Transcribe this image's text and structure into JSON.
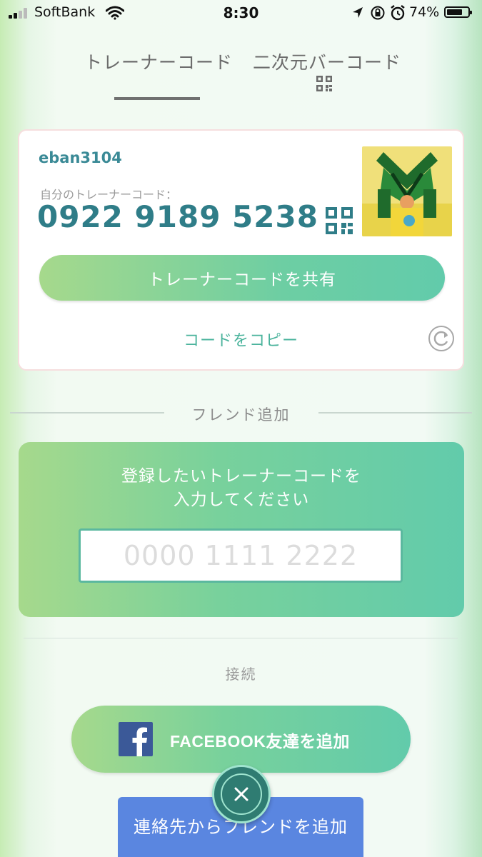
{
  "status_bar": {
    "carrier": "SoftBank",
    "time": "8:30",
    "battery_percent": "74%",
    "icons": [
      "signal-icon",
      "wifi-icon",
      "location-arrow-icon",
      "rotation-lock-icon",
      "alarm-icon",
      "battery-icon"
    ],
    "battery_level": 0.74
  },
  "tabs": [
    {
      "label": "トレーナーコード",
      "active": true
    },
    {
      "label": "二次元バーコード",
      "active": false,
      "icon": "qr-code-icon"
    }
  ],
  "trainer_card": {
    "username": "eban3104",
    "code_caption": "自分のトレーナーコード：",
    "code": "0922 9189 5238",
    "share_button_label": "トレーナーコードを共有",
    "copy_link_label": "コードをコピー",
    "icons": [
      "qr-code-icon",
      "refresh-icon",
      "avatar"
    ]
  },
  "friend_add": {
    "section_label": "フレンド追加",
    "prompt_line1": "登録したいトレーナーコードを",
    "prompt_line2": "入力してください",
    "input_placeholder": "0000 1111 2222",
    "input_value": ""
  },
  "connect": {
    "section_label": "接続",
    "facebook_button_label": "FACEBOOK友達を追加",
    "contacts_button_label": "連絡先からフレンドを追加"
  },
  "close_button": {
    "icon": "close-icon"
  },
  "colors": {
    "accent_teal": "#2f7d88",
    "gradient_green": "#a6d98c",
    "gradient_teal": "#62cbab",
    "facebook_blue": "#3b5998",
    "contacts_blue": "#5a86e0"
  }
}
